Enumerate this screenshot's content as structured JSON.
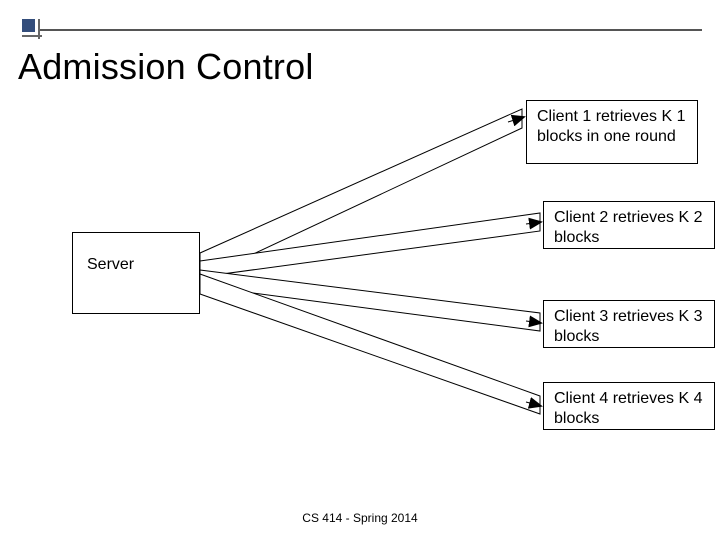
{
  "title": "Admission Control",
  "server": {
    "label": "Server"
  },
  "clients": [
    {
      "text": "Client 1 retrieves K 1 blocks in one round"
    },
    {
      "text": "Client 2 retrieves K 2 blocks"
    },
    {
      "text": "Client 3 retrieves K 3 blocks"
    },
    {
      "text": "Client 4 retrieves K 4 blocks"
    }
  ],
  "footer": "CS 414 - Spring 2014",
  "chart_data": {
    "type": "diagram",
    "title": "Admission Control",
    "nodes": [
      {
        "id": "server",
        "label": "Server"
      },
      {
        "id": "client1",
        "label": "Client 1 retrieves K 1 blocks in one round"
      },
      {
        "id": "client2",
        "label": "Client 2 retrieves K 2 blocks"
      },
      {
        "id": "client3",
        "label": "Client 3 retrieves K 3 blocks"
      },
      {
        "id": "client4",
        "label": "Client 4 retrieves K 4 blocks"
      }
    ],
    "edges": [
      {
        "from": "server",
        "to": "client1",
        "directed": true
      },
      {
        "from": "server",
        "to": "client2",
        "directed": true
      },
      {
        "from": "server",
        "to": "client3",
        "directed": true
      },
      {
        "from": "server",
        "to": "client4",
        "directed": true
      }
    ]
  }
}
